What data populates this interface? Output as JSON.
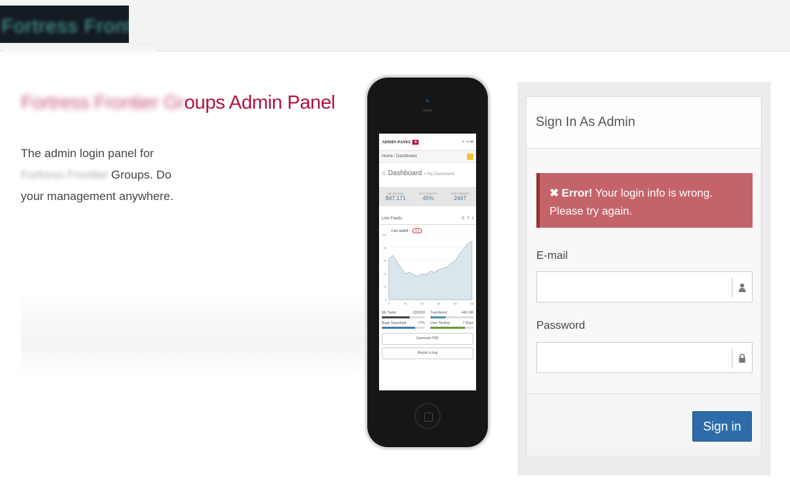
{
  "header": {
    "logo_text": "Fortress Frontier Groups"
  },
  "hero": {
    "title_blurred": "Fortress Frontier Gr",
    "title_visible": "oups Admin Panel",
    "desc_start": "The admin login panel for ",
    "desc_blur": "Fortress Frontier ",
    "desc_end": "Groups. Do your management anywhere."
  },
  "phone": {
    "brand": "ADMIN PANEL",
    "crumb": "Home / Dashboard",
    "page_title": "Dashboard",
    "page_sub": "> My Dashboard",
    "stats": [
      {
        "label": "MY INCOME",
        "value": "$47,171"
      },
      {
        "label": "SITE TRAFFIC",
        "value": "45%"
      },
      {
        "label": "SITE ORDERS",
        "value": "2447"
      }
    ],
    "tab_label": "Live Feeds",
    "live_switch": "Live switch",
    "live_off": "OFF",
    "chart_data": {
      "type": "area",
      "x": [
        0,
        5,
        10,
        15,
        20,
        25,
        30,
        35,
        40,
        45,
        50,
        55,
        60,
        65,
        70,
        75,
        80,
        85,
        90,
        95,
        100
      ],
      "values": [
        62,
        68,
        58,
        48,
        40,
        42,
        38,
        36,
        40,
        38,
        44,
        42,
        46,
        48,
        50,
        56,
        60,
        70,
        78,
        86,
        90
      ],
      "xlim": [
        0,
        100
      ],
      "ylim": [
        0,
        100
      ],
      "xticks": [
        "0",
        "20",
        "40",
        "60",
        "80",
        "100"
      ],
      "yticks": [
        "0",
        "20",
        "40",
        "60",
        "80",
        "100"
      ],
      "color": "#9fb6c8"
    },
    "progress": [
      {
        "label": "My Tasks",
        "value": "130/200",
        "fill": 0.65,
        "color": "#444444"
      },
      {
        "label": "Transfered",
        "value": "440 GB",
        "fill": 0.35,
        "color": "#4a8fb0"
      },
      {
        "label": "Bugs Squashed",
        "value": "77%",
        "fill": 0.77,
        "color": "#4a78b0"
      },
      {
        "label": "User Testing",
        "value": "7 Days",
        "fill": 0.8,
        "color": "#6a9a3a"
      }
    ],
    "btn_pdf": "Generate PDF",
    "btn_bug": "Report a bug"
  },
  "login": {
    "title": "Sign In As Admin",
    "error_strong": "Error!",
    "error_text": "Your login info is wrong. Please try again.",
    "email_label": "E-mail",
    "email_value": "",
    "password_label": "Password",
    "password_value": "",
    "submit_label": "Sign in"
  },
  "colors": {
    "accent": "#b3123f",
    "primary": "#2d6ca9",
    "error": "#c4646a"
  }
}
